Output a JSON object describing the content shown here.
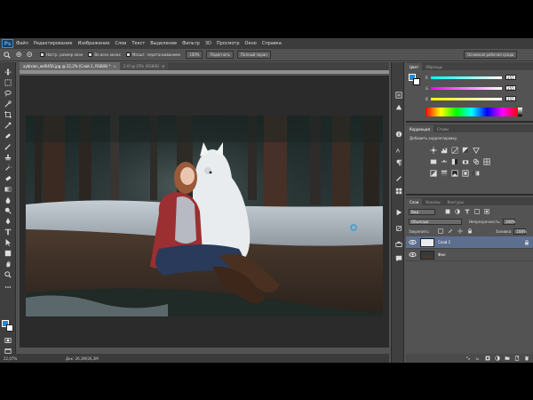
{
  "app": {
    "logo": "Ps",
    "menu": [
      "Файл",
      "Редактирование",
      "Изображение",
      "Слои",
      "Текст",
      "Выделение",
      "Фильтр",
      "3D",
      "Просмотр",
      "Окно",
      "Справка"
    ]
  },
  "options": {
    "resize_label": "Настр. размер окон",
    "all_windows_label": "Во всех окнах",
    "scrubby_label": "Масшт. перетаскиванием",
    "zoom_value": "100%",
    "fit_button": "Подогнать",
    "fill_button": "Полный экран",
    "workspace": "Основная рабочая среда"
  },
  "tabs": [
    {
      "label": "xyblxion_wd0456.jpg @ 22,2% (Слой 1, RGB/8) *",
      "active": true
    },
    {
      "label": "2.tif @ 25% (RGB/8)",
      "active": false
    }
  ],
  "status": {
    "zoom": "22,07%",
    "doc": "Док: 26,3М/26,3М"
  },
  "panels": {
    "color_tabs": [
      "Цвет",
      "Образцы"
    ],
    "color": {
      "fg_hex": "#1e8ad8",
      "sliders": [
        {
          "channel": "R",
          "value": "255",
          "gradient": "linear-gradient(to right,#00ffff,#ffffff)"
        },
        {
          "channel": "G",
          "value": "255",
          "gradient": "linear-gradient(to right,#ff00ff,#ffffff)"
        },
        {
          "channel": "B",
          "value": "255",
          "gradient": "linear-gradient(to right,#ffff00,#ffffff)"
        }
      ]
    },
    "adjust_tabs": [
      "Коррекция",
      "Стили"
    ],
    "adjust_title": "Добавить корректировку",
    "layers_tabs": [
      "Слои",
      "Каналы",
      "Контуры"
    ],
    "layers": {
      "kind": "Вид",
      "blend": "Обычные",
      "opacity_label": "Непрозрачность:",
      "opacity": "100%",
      "lock_label": "Закрепить:",
      "fill_label": "Заливка:",
      "fill": "100%",
      "items": [
        {
          "name": "Слой 1",
          "selected": true
        },
        {
          "name": "Фон",
          "selected": false
        }
      ]
    }
  }
}
